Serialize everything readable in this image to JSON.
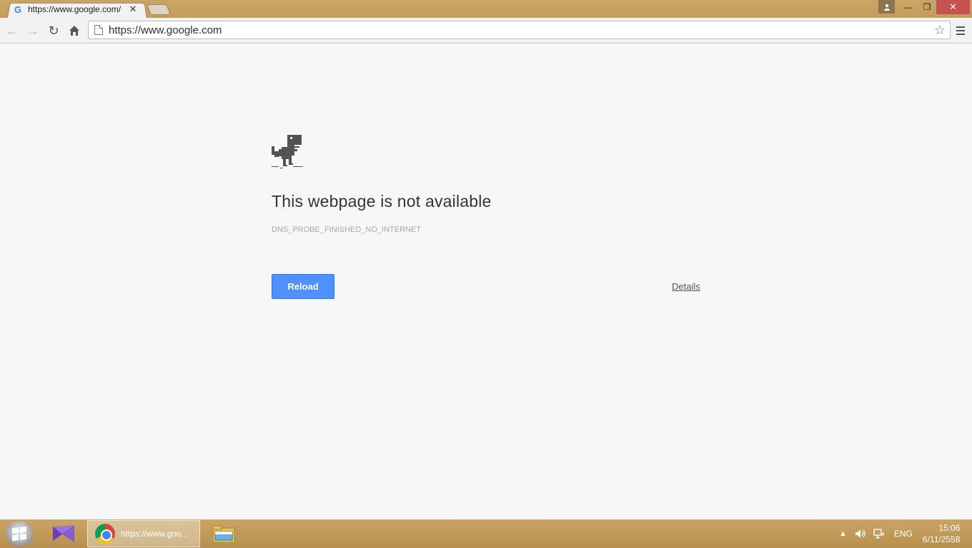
{
  "browser": {
    "tab": {
      "favicon": "G",
      "title": "https://www.google.com/",
      "close_glyph": "✕"
    },
    "window_controls": {
      "user_icon": "user-icon",
      "minimize_glyph": "—",
      "maximize_glyph": "❐",
      "close_glyph": "✕"
    },
    "toolbar": {
      "back_glyph": "←",
      "forward_glyph": "→",
      "reload_glyph": "↻",
      "home_glyph": "⌂",
      "url": "https://www.google.com",
      "star_glyph": "☆"
    }
  },
  "error_page": {
    "title": "This webpage is not available",
    "code": "DNS_PROBE_FINISHED_NO_INTERNET",
    "reload_label": "Reload",
    "details_label": "Details"
  },
  "taskbar": {
    "chrome_task_label": "https://www.goo...",
    "tray": {
      "language": "ENG",
      "time": "15:06",
      "date": "6/11/2558"
    }
  },
  "colors": {
    "accent_button": "#4d90fe",
    "titlebar": "#c9a565",
    "close_button": "#c75050"
  }
}
